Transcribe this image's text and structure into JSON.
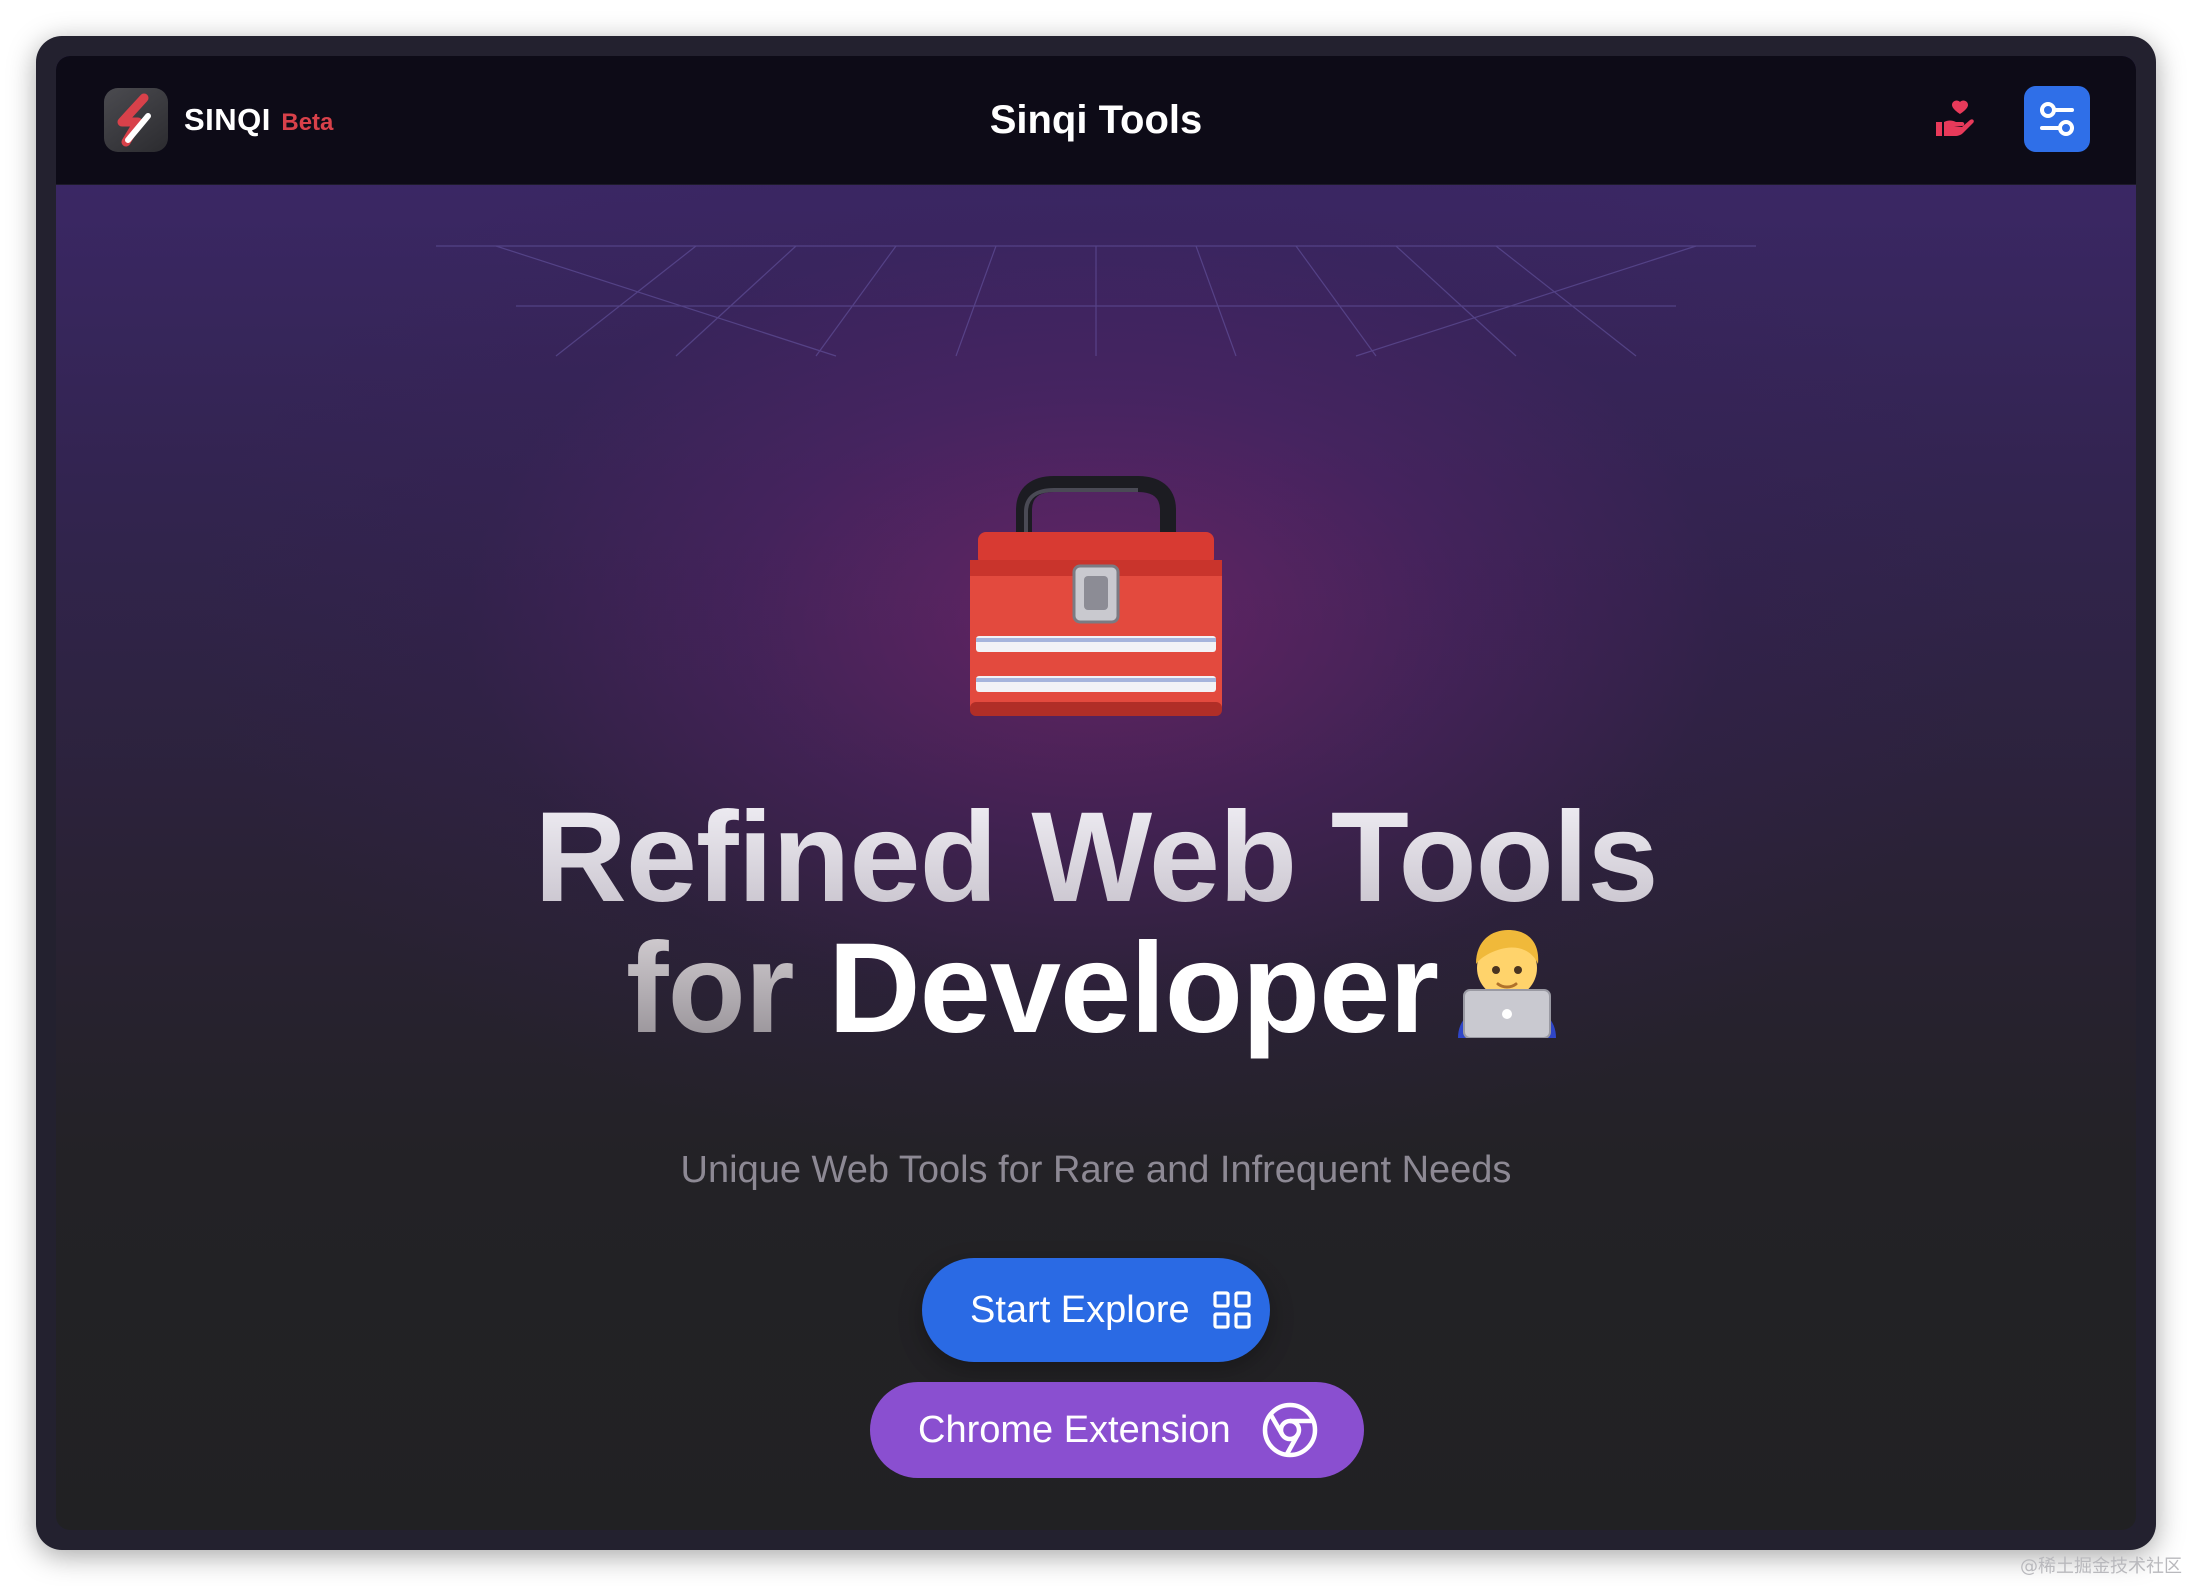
{
  "header": {
    "logo_name": "lightning-logo-icon",
    "brand_name": "SINQI",
    "brand_badge": "Beta",
    "title": "Sinqi Tools",
    "donate_icon": "hand-heart-icon",
    "settings_icon": "sliders-icon"
  },
  "hero": {
    "icon": "toolbox-emoji-icon",
    "headline_line1": "Refined Web Tools",
    "headline_for": "for",
    "headline_developer": "Developer",
    "headline_emoji": "technologist-emoji-icon",
    "subtitle": "Unique Web Tools for Rare and Infrequent Needs"
  },
  "actions": {
    "explore_label": "Start Explore",
    "explore_icon": "grid-icon",
    "chrome_label": "Chrome Extension",
    "chrome_icon": "chrome-icon"
  },
  "watermark": "@稀土掘金技术社区",
  "colors": {
    "primary_blue": "#2a6ae4",
    "purple": "#8a4fd0",
    "brand_red": "#d8414a",
    "header_bg": "#0d0b17"
  }
}
